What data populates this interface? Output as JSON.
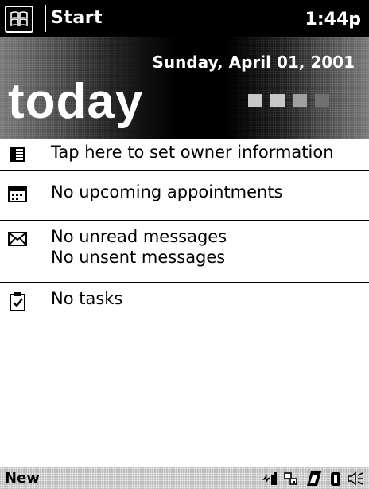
{
  "titlebar": {
    "start_label": "Start",
    "time": "1:44p",
    "start_icon": "windows-flag-icon"
  },
  "banner": {
    "date": "Sunday, April 01, 2001",
    "title": "today",
    "decoration": "square-dots"
  },
  "items": [
    {
      "icon": "owner-card-icon",
      "lines": [
        "Tap here to set owner information"
      ]
    },
    {
      "icon": "calendar-icon",
      "lines": [
        "No upcoming appointments"
      ]
    },
    {
      "icon": "envelope-icon",
      "lines": [
        "No unread messages",
        "No unsent messages"
      ]
    },
    {
      "icon": "tasks-clipboard-icon",
      "lines": [
        "No tasks"
      ]
    }
  ],
  "bottombar": {
    "new_label": "New",
    "tray_icons": [
      "signal-icon",
      "connectivity-icon",
      "ir-icon",
      "battery-icon",
      "speaker-icon"
    ]
  },
  "colors": {
    "titlebar_bg": "#000000",
    "bottombar_bg": "#bdbdbd"
  }
}
